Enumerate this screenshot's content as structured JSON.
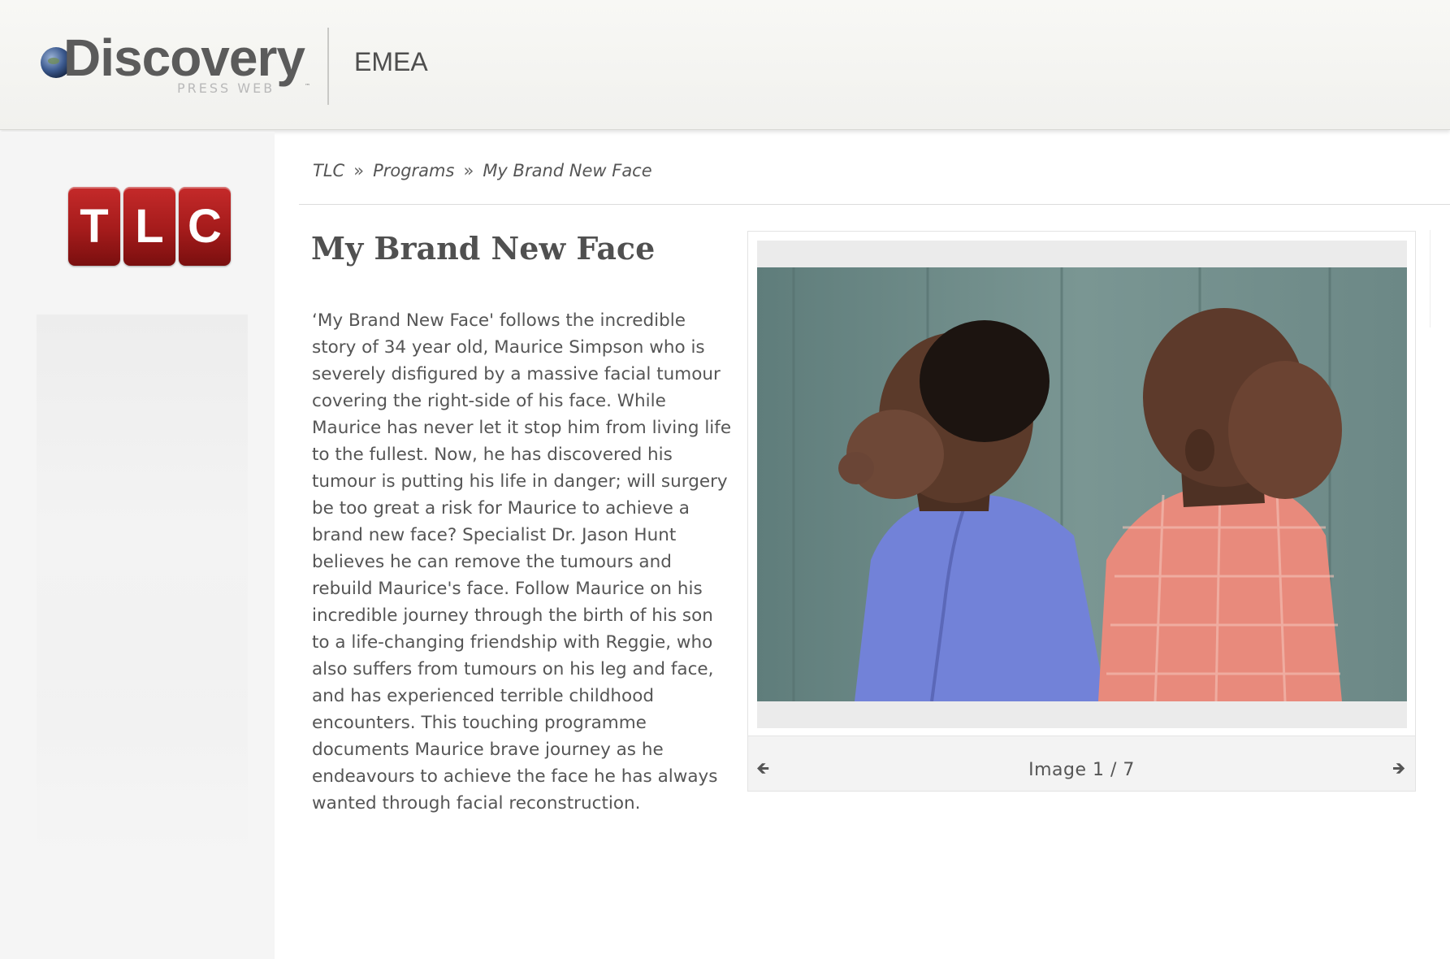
{
  "header": {
    "logo_text": "Discovery",
    "logo_subtext": "PRESS WEB",
    "logo_tm": "™",
    "region": "EMEA"
  },
  "sidebar": {
    "channel_logo_letters": [
      "T",
      "L",
      "C"
    ]
  },
  "breadcrumb": {
    "items": [
      "TLC",
      "Programs",
      "My Brand New Face"
    ],
    "separator": "»"
  },
  "page": {
    "title": "My Brand New Face",
    "description": "‘My Brand New Face' follows the incredible story of 34 year old, Maurice Simpson who is severely disfigured by a massive facial tumour covering the right-side of his face. While Maurice has never let it stop him from living life to the fullest. Now, he has discovered his tumour is putting his life in danger; will surgery be too great a risk for Maurice to achieve a brand new face? Specialist Dr. Jason Hunt believes he can remove the tumours and rebuild Maurice's face. Follow Maurice on his incredible journey through the birth of his son to a life-changing friendship with Reggie, who also suffers from tumours on his leg and face, and has experienced terrible childhood encounters. This touching programme documents Maurice brave journey as he endeavours to achieve the face he has always wanted through facial reconstruction."
  },
  "gallery": {
    "counter": "Image 1 / 7",
    "prev_icon": "arrow-left-icon",
    "next_icon": "arrow-right-icon"
  },
  "colors": {
    "tlc_red": "#b32020",
    "header_bg": "#f4f4f1",
    "sidebar_bg": "#f5f5f5",
    "text": "#555555"
  }
}
